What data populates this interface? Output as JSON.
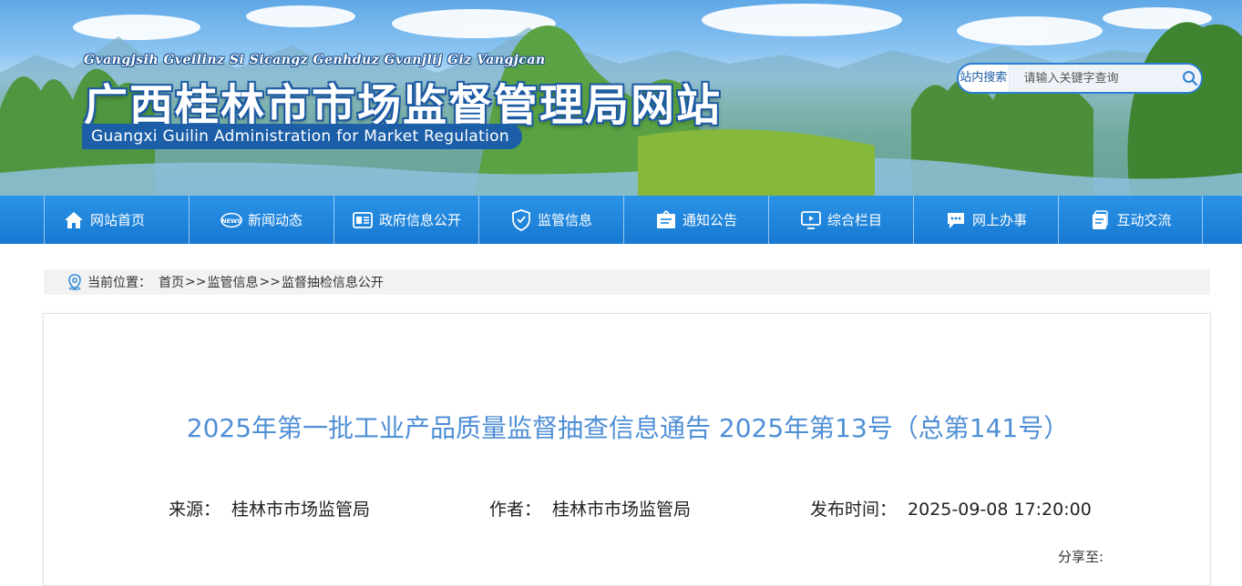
{
  "header": {
    "subtitle_zhuang": "Gvangjsih Gveilinz Si Sicangz Genhduz Gvanjlij Giz Vangjcan",
    "site_title": "广西桂林市市场监督管理局网站",
    "site_title_en": "Guangxi Guilin Administration for Market Regulation",
    "search": {
      "label": "站内搜索",
      "placeholder": "请输入关键字查询",
      "icon": "search-icon"
    }
  },
  "nav": {
    "items": [
      {
        "label": "网站首页",
        "icon": "home-icon"
      },
      {
        "label": "新闻动态",
        "icon": "news-icon"
      },
      {
        "label": "政府信息公开",
        "icon": "gov-info-icon"
      },
      {
        "label": "监管信息",
        "icon": "shield-icon"
      },
      {
        "label": "通知公告",
        "icon": "notice-icon"
      },
      {
        "label": "综合栏目",
        "icon": "screen-icon"
      },
      {
        "label": "网上办事",
        "icon": "chat-icon"
      },
      {
        "label": "互动交流",
        "icon": "document-icon"
      }
    ]
  },
  "breadcrumb": {
    "prefix": "当前位置：",
    "items": [
      "首页",
      "监管信息",
      "监督抽检信息公开"
    ],
    "separator": ">>",
    "icon": "location-icon"
  },
  "article": {
    "title": "2025年第一批工业产品质量监督抽查信息通告 2025年第13号（总第141号）",
    "source_label": "来源：",
    "source": "桂林市市场监管局",
    "author_label": "作者：",
    "author": "桂林市市场监管局",
    "time_label": "发布时间：",
    "time": "2025-09-08 17:20:00",
    "share_label": "分享至:"
  },
  "colors": {
    "nav_blue": "#1f86dc",
    "title_blue": "#4f8fd6",
    "banner_text_outline": "#1b5aa3"
  }
}
